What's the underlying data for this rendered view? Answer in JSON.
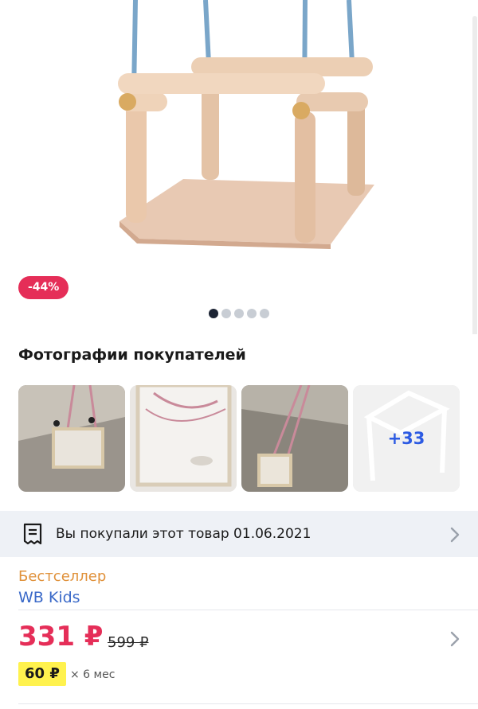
{
  "product": {
    "discount": "-44%",
    "gallery_dots": 5,
    "active_dot": 0
  },
  "customer_photos": {
    "title": "Фотографии покупателей",
    "more_label": "+33"
  },
  "purchase_info": {
    "text": "Вы покупали этот товар 01.06.2021",
    "icon": "receipt-icon"
  },
  "labels": {
    "badge": "Бестселлер",
    "brand": "WB Kids"
  },
  "pricing": {
    "price": "331 ₽",
    "old_price": "599 ₽",
    "installment": "60 ₽",
    "installment_term": "× 6 мес"
  },
  "colors": {
    "discount": "#e52e58",
    "price": "#e52e58",
    "brand": "#3a69c8",
    "badge": "#e0913a",
    "installment_bg": "#fff24e",
    "more_photos": "#2d5be3"
  }
}
